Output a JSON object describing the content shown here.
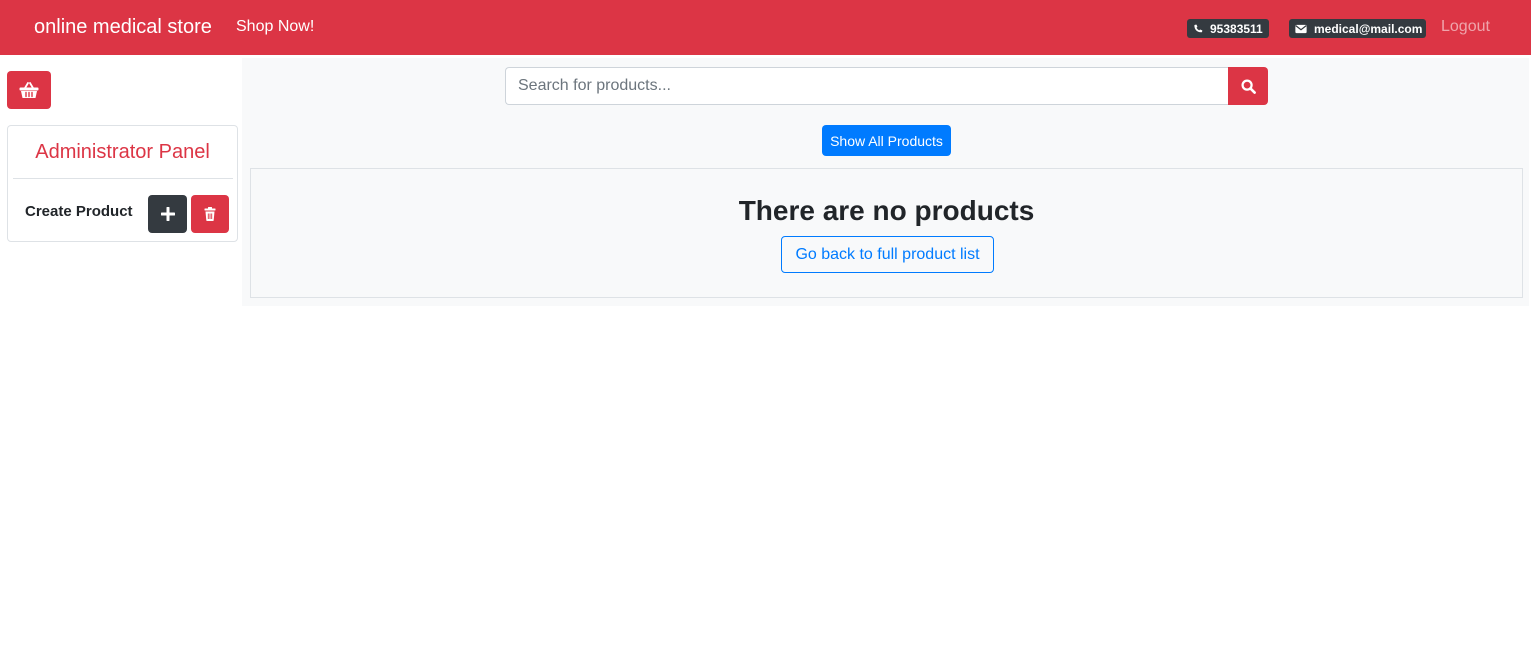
{
  "navbar": {
    "brand": "online medical store",
    "shop_link": "Shop Now!",
    "phone": "95383511",
    "email": "medical@mail.com",
    "logout": "Logout",
    "phone_icon": "phone-icon",
    "mail_icon": "envelope-icon"
  },
  "sidebar": {
    "cart_icon": "shopping-basket-icon",
    "admin_title": "Administrator Panel",
    "create_label": "Create Product",
    "add_icon": "plus-icon",
    "delete_icon": "trash-icon"
  },
  "search": {
    "placeholder": "Search for products...",
    "value": "",
    "icon": "search-icon"
  },
  "main": {
    "show_all_label": "Show All Products",
    "empty_message": "There are no products",
    "go_back_label": "Go back to full product list"
  },
  "colors": {
    "brand_red": "#dc3545",
    "primary_blue": "#007bff",
    "dark": "#343a40",
    "light_bg": "#f8f9fa"
  }
}
